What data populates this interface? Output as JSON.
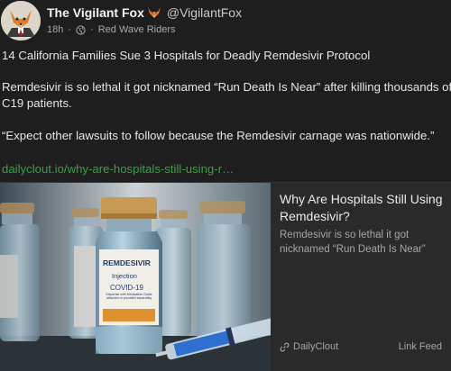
{
  "post": {
    "display_name": "The Vigilant Fox",
    "handle": "@VigilantFox",
    "time_ago": "18h",
    "separator": "·",
    "group": "Red Wave Riders"
  },
  "body": {
    "p1": "14 California Families Sue 3 Hospitals for Deadly Remdesivir Protocol",
    "p2_line1": "Remdesivir is so lethal it got nicknamed “Run Death Is Near” after killing thousands of",
    "p2_line2": "C19 patients.",
    "p3": "“Expect other lawsuits to follow because the Remdesivir carnage was nationwide.”",
    "link": "dailyclout.io/why-are-hospitals-still-using-r…"
  },
  "card": {
    "title": "Why Are Hospitals Still Using Remdesivir?",
    "description": "Remdesivir is so lethal it got nicknamed “Run Death Is Near”",
    "source": "DailyClout",
    "feed": "Link Feed",
    "vial_label_brand": "REMDESIVIR",
    "vial_label_line2": "Injection",
    "vial_label_line3": "COVID-19",
    "vial_label_fine": "Dispense with Medication Guide attached or provided separately"
  },
  "icons": {
    "avatar": "fox-avatar",
    "emoji": "fox-emoji",
    "globe": "globe-icon",
    "link": "link-icon"
  },
  "colors": {
    "background": "#1e1e1e",
    "link": "#3aa047",
    "card_bg": "#2a2a2a"
  }
}
